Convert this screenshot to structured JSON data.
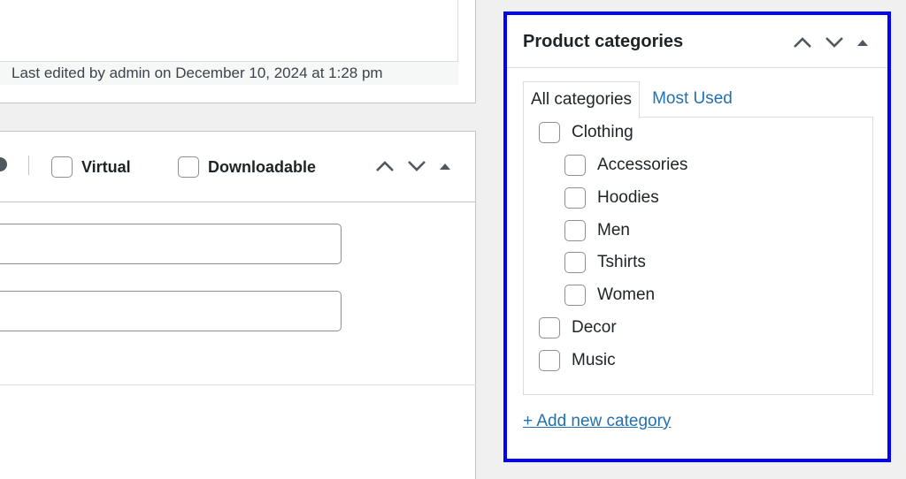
{
  "editor": {
    "last_edited": "Last edited by admin on December 10, 2024 at 1:28 pm"
  },
  "product_data": {
    "virtual_label": "Virtual",
    "downloadable_label": "Downloadable"
  },
  "categories_box": {
    "title": "Product categories",
    "tabs": [
      {
        "label": "All categories",
        "active": true
      },
      {
        "label": "Most Used",
        "active": false
      }
    ],
    "items": [
      {
        "label": "Clothing",
        "level": 0,
        "checked": false
      },
      {
        "label": "Accessories",
        "level": 1,
        "checked": false
      },
      {
        "label": "Hoodies",
        "level": 1,
        "checked": false
      },
      {
        "label": "Men",
        "level": 1,
        "checked": false
      },
      {
        "label": "Tshirts",
        "level": 1,
        "checked": false
      },
      {
        "label": "Women",
        "level": 1,
        "checked": false
      },
      {
        "label": "Decor",
        "level": 0,
        "checked": false
      },
      {
        "label": "Music",
        "level": 0,
        "checked": false
      }
    ],
    "add_new_label": "+ Add new category"
  },
  "colors": {
    "highlight_border": "#0000ff",
    "link": "#2271b1"
  },
  "icons": [
    "chevron-up-icon",
    "chevron-down-icon",
    "triangle-up-icon"
  ]
}
